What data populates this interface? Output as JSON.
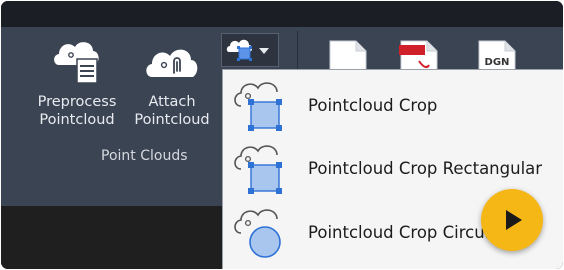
{
  "ribbon": {
    "tools": [
      {
        "label_line1": "Preprocess",
        "label_line2": "Pointcloud",
        "icon": "cloud-document-icon"
      },
      {
        "label_line1": "Attach",
        "label_line2": "Pointcloud",
        "icon": "cloud-attach-icon"
      }
    ],
    "group_label": "Point Clouds",
    "split_button_icon": "pointcloud-crop-icon",
    "right_tools": [
      {
        "icon": "blank-page-icon"
      },
      {
        "icon": "pdf-page-icon"
      },
      {
        "icon": "dgn-page-icon",
        "text": "DGN"
      }
    ]
  },
  "menu": {
    "items": [
      {
        "label": "Pointcloud Crop",
        "icon": "crop-polygon-icon"
      },
      {
        "label": "Pointcloud Crop Rectangular",
        "icon": "crop-rectangle-icon"
      },
      {
        "label": "Pointcloud Crop Circular",
        "icon": "crop-circle-icon"
      }
    ]
  },
  "overlay": {
    "play_icon": "play-icon"
  },
  "colors": {
    "ribbon_bg": "#3b4453",
    "menu_bg": "#f5f5f5",
    "accent_blue": "#2f72d6",
    "play_yellow": "#f5b715"
  }
}
